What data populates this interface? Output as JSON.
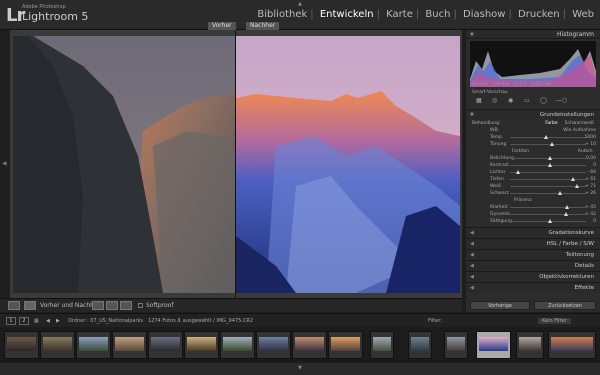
{
  "app": {
    "brand_small": "Adobe Photoshop",
    "brand_big": "Lightroom 5",
    "logo": "Lr"
  },
  "modules": [
    {
      "label": "Bibliothek",
      "active": false
    },
    {
      "label": "Entwickeln",
      "active": true
    },
    {
      "label": "Karte",
      "active": false
    },
    {
      "label": "Buch",
      "active": false
    },
    {
      "label": "Diashow",
      "active": false
    },
    {
      "label": "Drucken",
      "active": false
    },
    {
      "label": "Web",
      "active": false
    }
  ],
  "view": {
    "before_label": "Vorher",
    "after_label": "Nachher"
  },
  "toolbar": {
    "mode_label": "Vorher und Nachher:",
    "softproof_label": "Softproof"
  },
  "right_panel": {
    "histogram_title": "Histogramm",
    "histogram_info": [
      "ISO 100",
      "240 mm",
      "f / 5,0",
      "1/250 Sek."
    ],
    "smart_preview": "Smart-Vorschau",
    "basic_title": "Grundeinstellungen",
    "treatment_label": "Behandlung:",
    "treatment_options": [
      "Farbe",
      "Schwarzweiß"
    ],
    "wb_label": "WB:",
    "wb_value": "Wie Aufnahme",
    "temp_label": "Temp",
    "temp_value": "5000",
    "tint_label": "Tönung",
    "tint_value": "+ 10",
    "tone_label": "Farbton",
    "tone_auto": "Autom.",
    "tone_rows": [
      {
        "label": "Belichtung",
        "value": "0,00"
      },
      {
        "label": "Kontrast",
        "value": "0"
      },
      {
        "label": "Lichter",
        "value": "- 84"
      },
      {
        "label": "Tiefen",
        "value": "+ 61"
      },
      {
        "label": "Weiß",
        "value": "+ 71"
      },
      {
        "label": "Schwarz",
        "value": "+ 26"
      }
    ],
    "presence_label": "Präsenz",
    "presence_rows": [
      {
        "label": "Klarheit",
        "value": "+ 45"
      },
      {
        "label": "Dynamik",
        "value": "+ 42"
      },
      {
        "label": "Sättigung",
        "value": "0"
      }
    ],
    "collapsed_sections": [
      "Gradationskurve",
      "HSL / Farbe / S/W",
      "Teiltonung",
      "Details",
      "Objektivkorrekturen",
      "Effekte"
    ],
    "prev_button": "Vorherige",
    "reset_button": "Zurücksetzen"
  },
  "filmstrip_bar": {
    "page_1": "1",
    "page_2": "2",
    "folder_info": "Ordner : 07_US_Nationalparks",
    "count_info": "1274 Fotos /",
    "selected_info": "1 ausgewählt / IMG_9475.CR2",
    "filter_label": "Filter:",
    "filter_value": "Kein Filter"
  },
  "colors": {
    "accent": "#e8e8e8",
    "panel_bg": "#2c2c2c"
  }
}
